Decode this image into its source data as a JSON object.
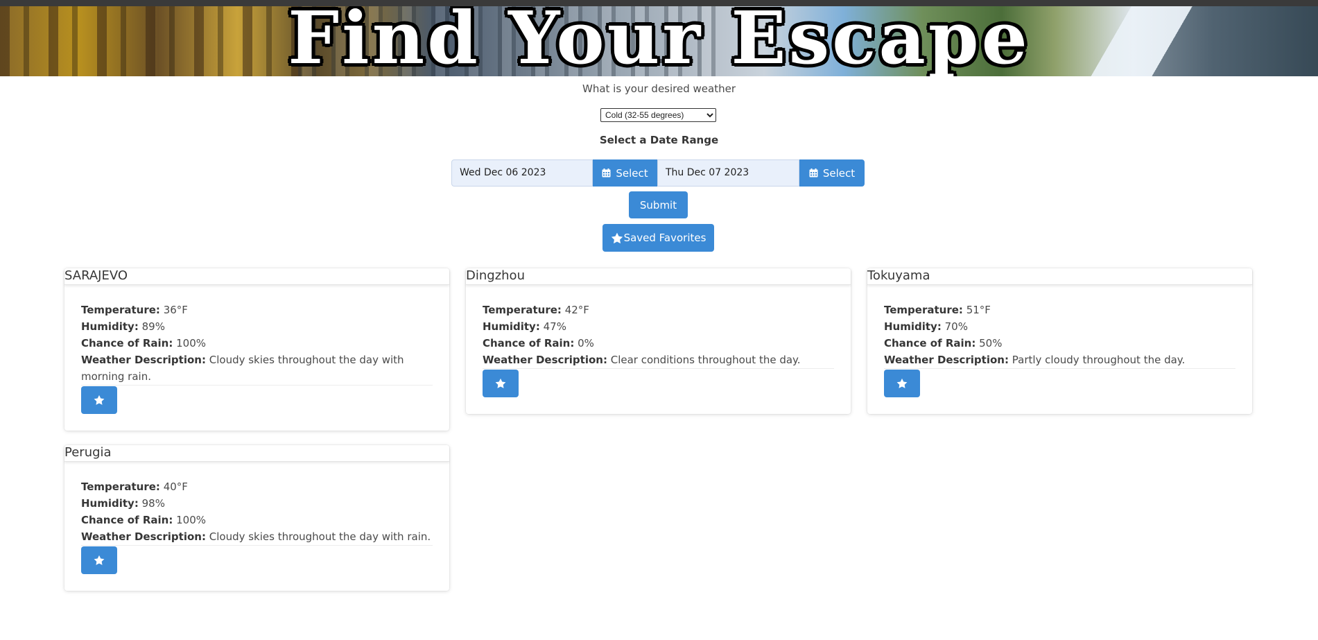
{
  "banner": {
    "title": "Find Your Escape"
  },
  "form": {
    "question": "What is your desired weather",
    "weather_selected": "Cold (32-55 degrees)",
    "date_range_label": "Select a Date Range",
    "start_date": "Wed Dec 06 2023",
    "end_date": "Thu Dec 07 2023",
    "select_label": "Select",
    "submit_label": "Submit",
    "saved_favorites_label": "Saved Favorites"
  },
  "field_labels": {
    "temperature": "Temperature:",
    "humidity": "Humidity:",
    "rain": "Chance of Rain:",
    "description": "Weather Description:"
  },
  "cities": [
    {
      "name": "SARAJEVO",
      "temperature": "36°F",
      "humidity": "89%",
      "rain": "100%",
      "description": "Cloudy skies throughout the day with morning rain."
    },
    {
      "name": "Dingzhou",
      "temperature": "42°F",
      "humidity": "47%",
      "rain": "0%",
      "description": "Clear conditions throughout the day."
    },
    {
      "name": "Tokuyama",
      "temperature": "51°F",
      "humidity": "70%",
      "rain": "50%",
      "description": "Partly cloudy throughout the day."
    },
    {
      "name": "Perugia",
      "temperature": "40°F",
      "humidity": "98%",
      "rain": "100%",
      "description": "Cloudy skies throughout the day with rain."
    }
  ],
  "colors": {
    "accent": "#3b8ad6",
    "text": "#4a4a4a",
    "heading": "#363636"
  }
}
